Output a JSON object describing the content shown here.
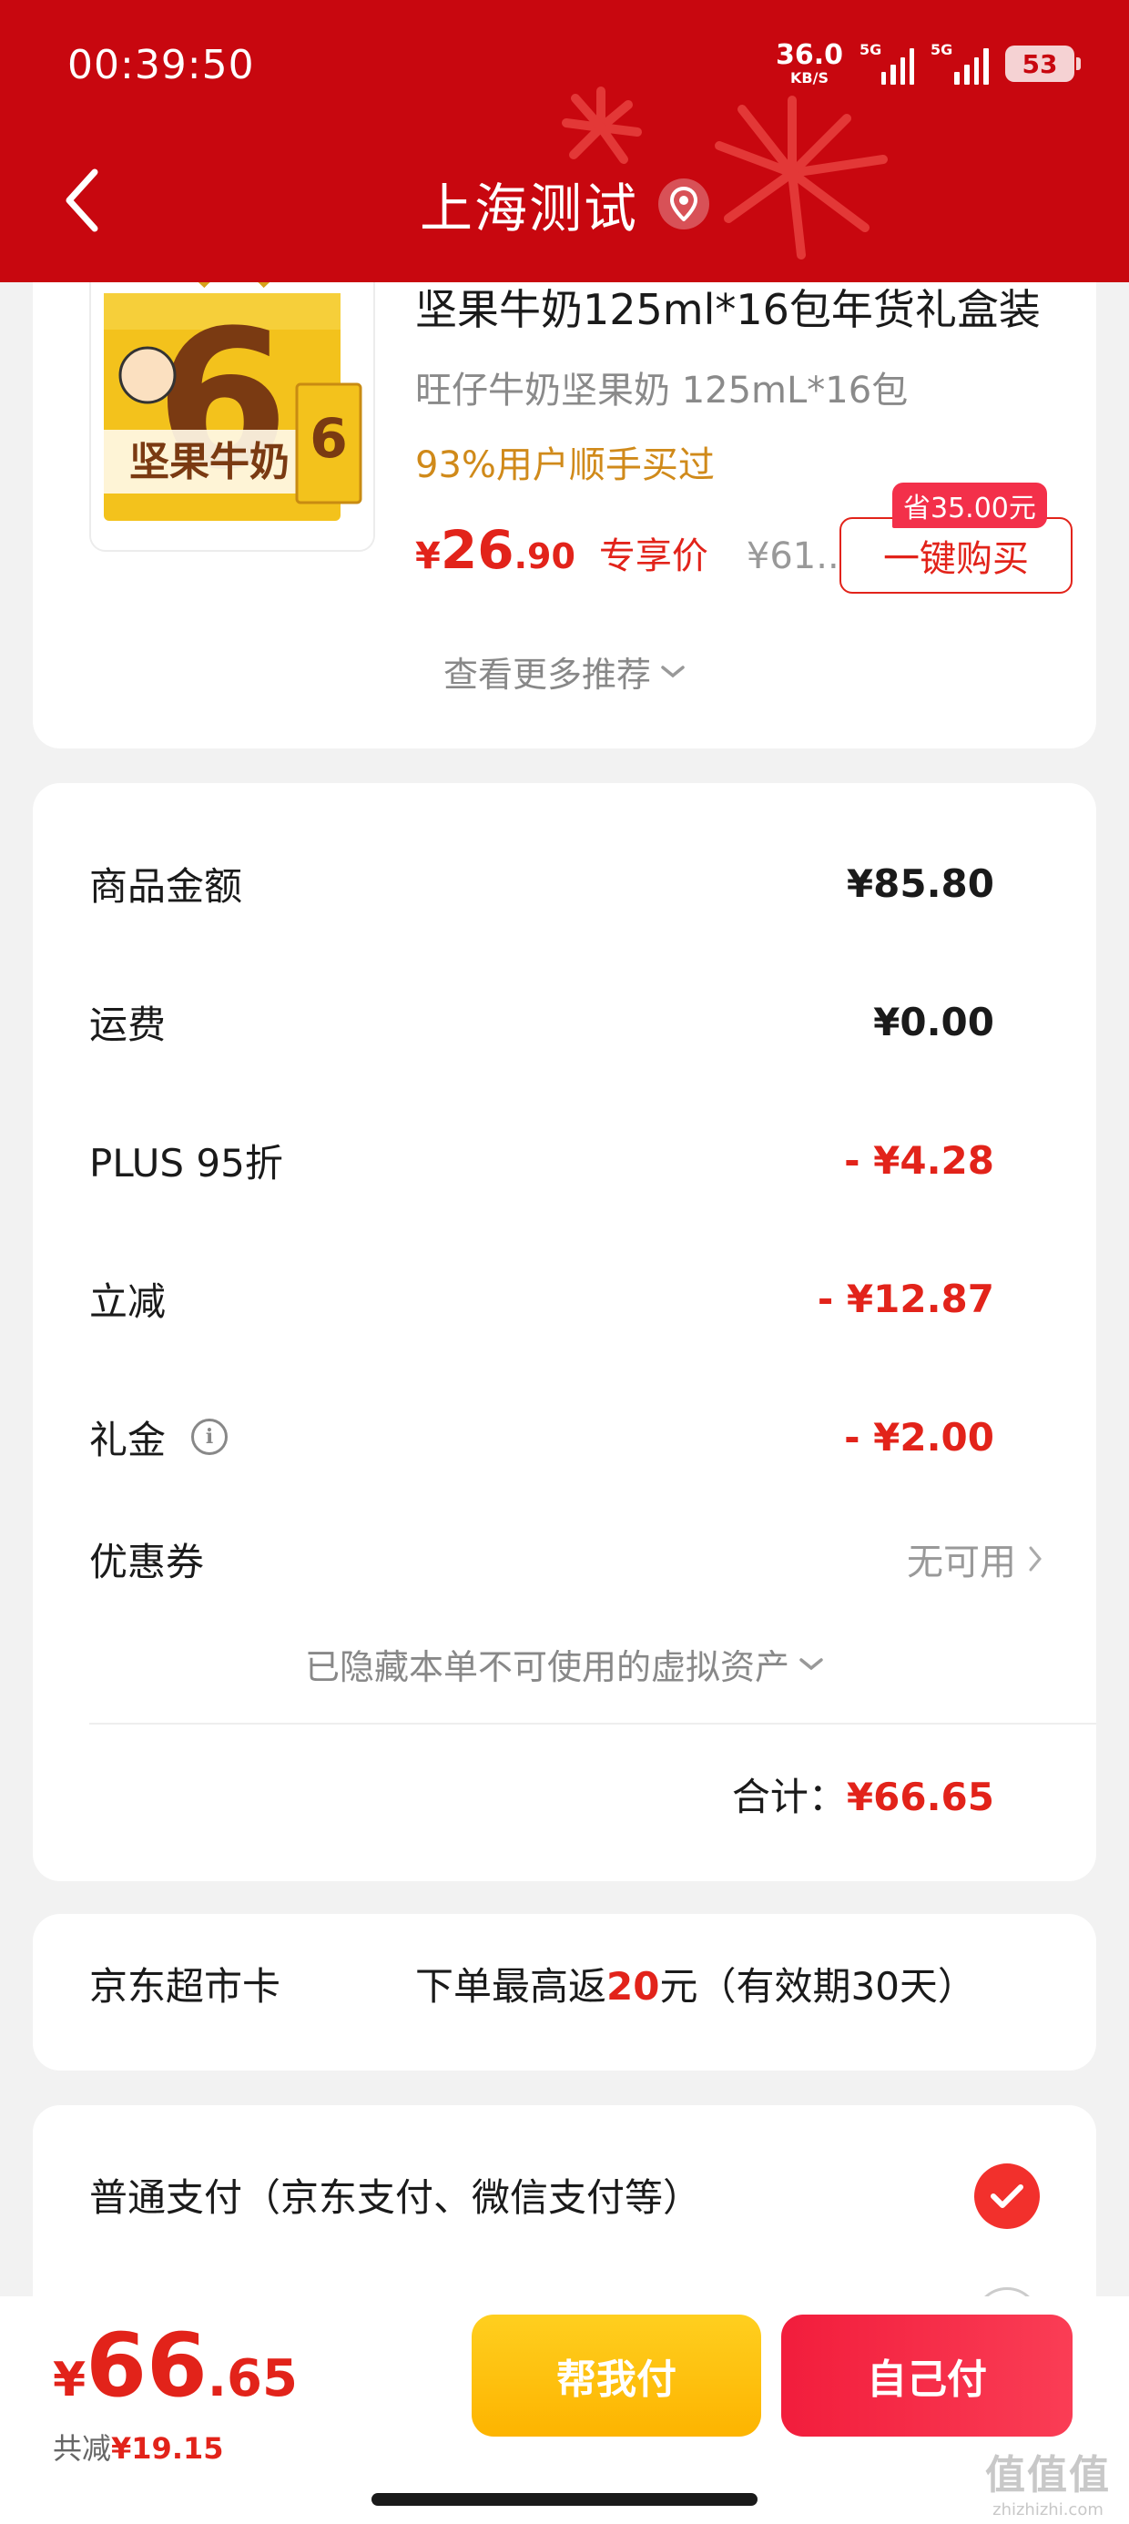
{
  "status_bar": {
    "time": "00:39:50",
    "net_speed": "36.0",
    "net_unit": "KB/S",
    "signal1_tag": "5G",
    "signal2_tag": "5G",
    "battery": "53"
  },
  "header": {
    "title": "上海测试",
    "background_color": "#c8070f"
  },
  "product": {
    "name": "坚果牛奶125ml*16包年货礼盒装",
    "spec": "旺仔牛奶坚果奶 125mL*16包",
    "tip": "93%用户顺手买过",
    "price_symbol": "¥",
    "price_int": "26",
    "price_dec": ".90",
    "exclusive_label": "专享价",
    "original_price": "¥61....",
    "buy_button": "一键购买",
    "save_badge": "省35.00元",
    "more_recommend": "查看更多推荐",
    "image_text": "坚果牛奶"
  },
  "summary": {
    "rows": [
      {
        "label": "商品金额",
        "value": "¥85.80"
      },
      {
        "label": "运费",
        "value": "¥0.00"
      },
      {
        "label": "PLUS 95折",
        "value": "- ¥4.28"
      },
      {
        "label": "立减",
        "value": "- ¥12.87"
      },
      {
        "label": "礼金",
        "value": "- ¥2.00"
      }
    ],
    "coupon_label": "优惠券",
    "coupon_value": "无可用",
    "hidden_assets": "已隐藏本单不可使用的虚拟资产",
    "total_label": "合计：",
    "total_value": "¥66.65"
  },
  "jd_card": {
    "label": "京东超市卡",
    "desc_prefix": "下单最高返",
    "desc_highlight": "20",
    "desc_suffix": "元（有效期30天）"
  },
  "payment": {
    "option1": "普通支付（京东支付、微信支付等）"
  },
  "bottom": {
    "price_symbol": "¥",
    "price_int": "66",
    "price_dec": ".65",
    "reduced_label": "共减",
    "reduced_value": "¥19.15",
    "help_pay": "帮我付",
    "self_pay": "自己付",
    "watermark": "值值值",
    "watermark_url": "zhizhizhi.com"
  },
  "colors": {
    "accent_red": "#e2231a",
    "gold": "#fdb400"
  }
}
